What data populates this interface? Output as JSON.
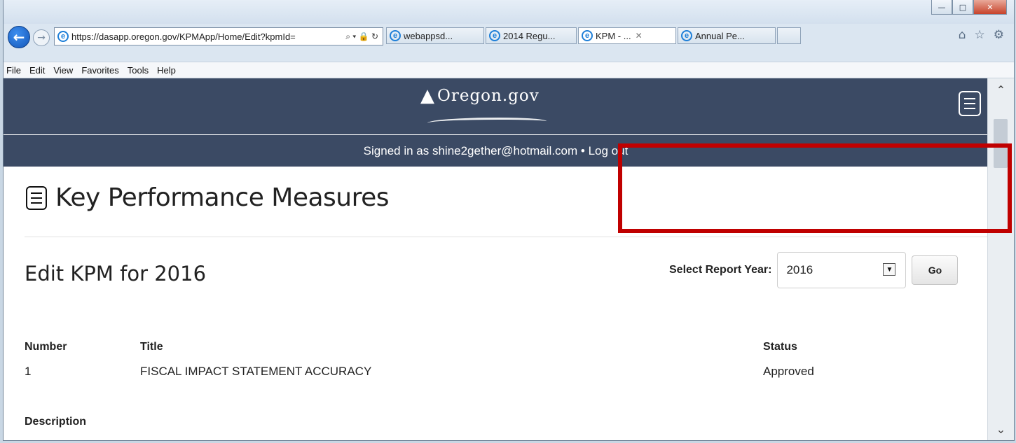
{
  "browser": {
    "url": "https://dasapp.oregon.gov/KPMApp/Home/Edit?kpmId=",
    "url_controls": "⌕ ▾ 🔒 ↻",
    "tabs": [
      "webappsd...",
      "2014 Regu...",
      "KPM - ...",
      "Annual Pe..."
    ],
    "active_tab_index": 2,
    "menu": [
      "File",
      "Edit",
      "View",
      "Favorites",
      "Tools",
      "Help"
    ],
    "window_controls": [
      "minimize-icon",
      "maximize-icon",
      "close-icon"
    ],
    "toolbar_icons": [
      "home-icon",
      "favorites-star-icon",
      "settings-gear-icon"
    ]
  },
  "site": {
    "logo_text": "Oregon.gov",
    "signed_in_text": "Signed in as shine2gether@hotmail.com •",
    "logout_label": "Log out",
    "header_color": "#3b4a64"
  },
  "page": {
    "title": "Key Performance Measures",
    "subtitle": "Edit KPM for 2016",
    "select_label": "Select Report Year:",
    "selected_year": "2016",
    "go_label": "Go",
    "highlight_color": "#c00000"
  },
  "table": {
    "headers": {
      "number": "Number",
      "title": "Title",
      "status": "Status"
    },
    "rows": [
      {
        "number": "1",
        "title": "FISCAL IMPACT STATEMENT ACCURACY",
        "status": "Approved"
      }
    ],
    "next_section": "Description"
  }
}
